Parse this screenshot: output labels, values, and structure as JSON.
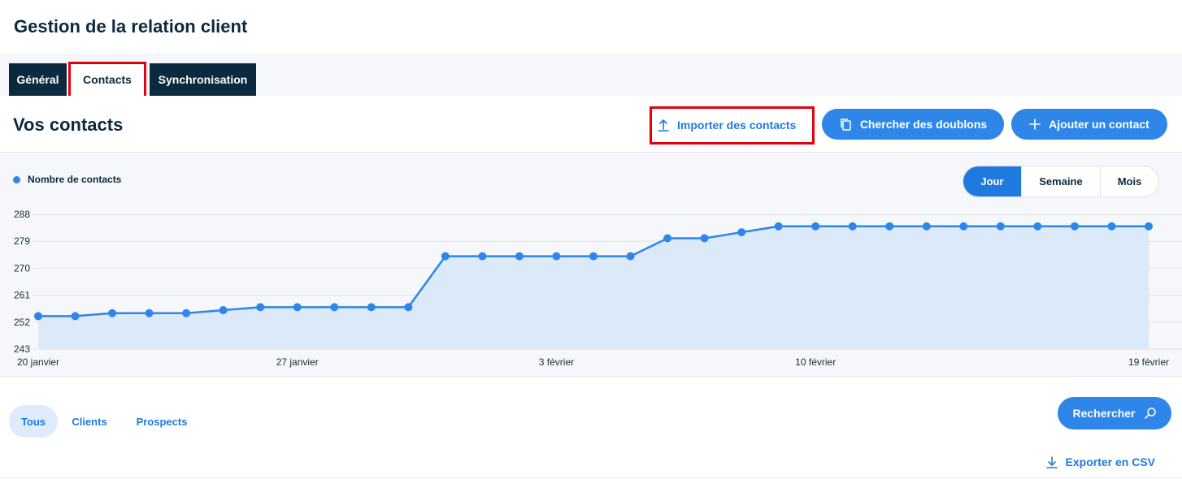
{
  "page": {
    "title": "Gestion de la relation client"
  },
  "tabs": [
    {
      "label": "Général",
      "active": false
    },
    {
      "label": "Contacts",
      "active": true
    },
    {
      "label": "Synchronisation",
      "active": false
    }
  ],
  "section": {
    "title": "Vos contacts",
    "import_label": "Importer des contacts",
    "doublons_label": "Chercher des doublons",
    "add_label": "Ajouter un contact"
  },
  "period": {
    "options": [
      "Jour",
      "Semaine",
      "Mois"
    ],
    "selected": "Jour"
  },
  "chart_data": {
    "type": "area",
    "legend_position": "top-left",
    "grid": true,
    "series": [
      {
        "name": "Nombre de contacts",
        "color": "#2d86e8",
        "values": [
          254,
          254,
          255,
          255,
          255,
          256,
          257,
          257,
          257,
          257,
          257,
          274,
          274,
          274,
          274,
          274,
          274,
          280,
          280,
          282,
          284,
          284,
          284,
          284,
          284,
          284,
          284,
          284,
          284,
          284,
          284
        ]
      }
    ],
    "x_tick_labels": [
      "20 janvier",
      "27 janvier",
      "3 février",
      "10 février",
      "19 février"
    ],
    "x_tick_index": [
      0,
      7,
      14,
      21,
      30
    ],
    "y_ticks": [
      243,
      252,
      261,
      270,
      279,
      288
    ],
    "ylim": [
      243,
      288
    ]
  },
  "filters": {
    "chips": [
      {
        "label": "Tous",
        "active": true
      },
      {
        "label": "Clients",
        "active": false
      },
      {
        "label": "Prospects",
        "active": false
      }
    ],
    "search_label": "Rechercher",
    "export_label": "Exporter en CSV"
  },
  "colors": {
    "accent": "#2d86e8",
    "dark": "#0b2a3d",
    "highlight": "#e3000f"
  }
}
